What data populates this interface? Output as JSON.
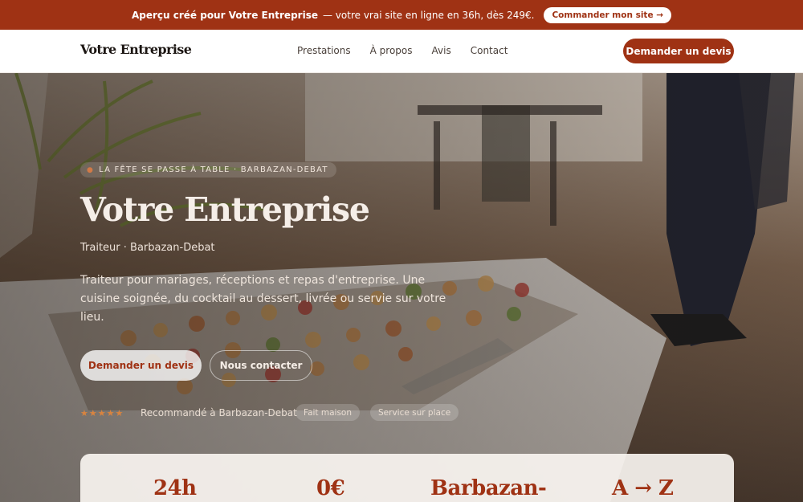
{
  "promo": {
    "prefix": "Aperçu créé pour Votre Entreprise",
    "text": "— votre vrai site en ligne en 36h, dès 249€.",
    "cta": "Commander mon site →"
  },
  "header": {
    "brand": "Votre Entreprise",
    "nav": [
      "Prestations",
      "À propos",
      "Avis",
      "Contact"
    ],
    "cta": "Demander un devis"
  },
  "hero": {
    "kicker": "LA FÊTE SE PASSE À TABLE · BARBAZAN-DEBAT",
    "title": "Votre Entreprise",
    "subtitle": "Traiteur · Barbazan-Debat",
    "lead": "Traiteur pour mariages, réceptions et repas d'entreprise. Une cuisine soignée, du cocktail au dessert, livrée ou servie sur votre lieu.",
    "primary_cta": "Demander un devis",
    "secondary_cta": "Nous contacter",
    "stars": "★★★★★",
    "recommendation": "Recommandé à Barbazan-Debat",
    "chips": [
      "Fait maison",
      "Service sur place"
    ]
  },
  "stats": [
    "24h",
    "0€",
    "Barbazan-",
    "A → Z"
  ],
  "colors": {
    "accent": "#9f3214",
    "star": "#d9843f"
  }
}
